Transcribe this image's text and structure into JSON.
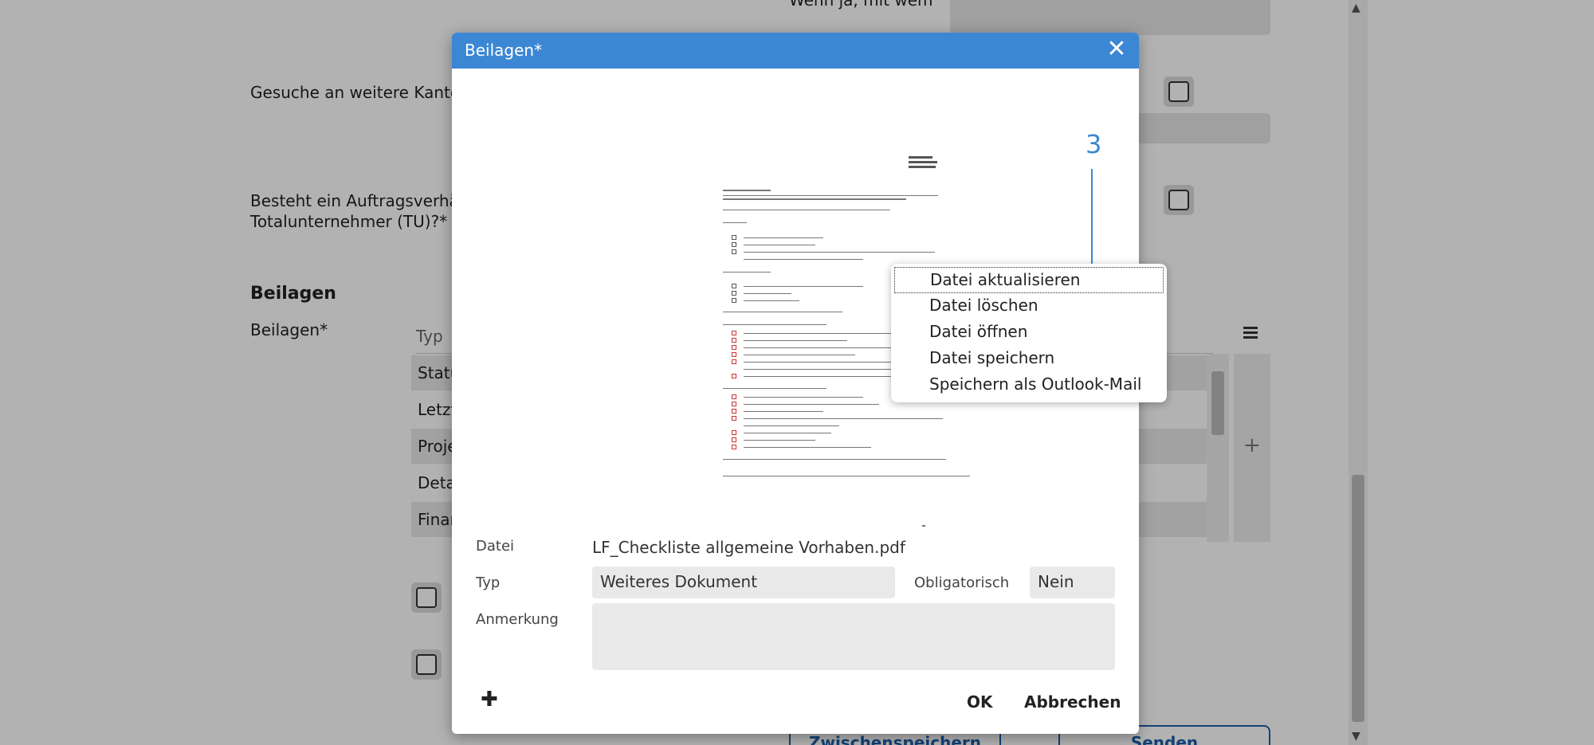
{
  "background": {
    "question_top": "Wenn ja, mit wem",
    "question_cantons": "Gesuche an weitere Kanton",
    "question_order_line1": "Besteht ein Auftragsverhält",
    "question_order_line2": "Totalunternehmer (TU)?*",
    "section_heading": "Beilagen",
    "attachments_label": "Beilagen*",
    "table_header_type": "Typ",
    "table_rows": [
      "Statu",
      "Letzt",
      "Proje",
      "Deta",
      "Finar"
    ],
    "table_menu_icon": "hamburger-icon",
    "table_add_icon": "plus-icon",
    "button_save_draft": "Zwischenspeichern",
    "button_send": "Senden"
  },
  "dialog": {
    "title": "Beilagen*",
    "close_icon": "close-icon",
    "annotation_number": "3",
    "context_menu": [
      "Datei aktualisieren",
      "Datei löschen",
      "Datei öffnen",
      "Datei speichern",
      "Speichern als Outlook-Mail"
    ],
    "file_label": "Datei",
    "file_value": "LF_Checkliste allgemeine Vorhaben.pdf",
    "type_label": "Typ",
    "type_value": "Weiteres Dokument",
    "mandatory_label": "Obligatorisch",
    "mandatory_value": "Nein",
    "remark_label": "Anmerkung",
    "remark_value": "",
    "add_icon": "plus-icon",
    "ok_label": "OK",
    "cancel_label": "Abbrechen"
  },
  "colors": {
    "header_blue": "#3b87d3",
    "annotation_blue": "#3b87d3"
  }
}
